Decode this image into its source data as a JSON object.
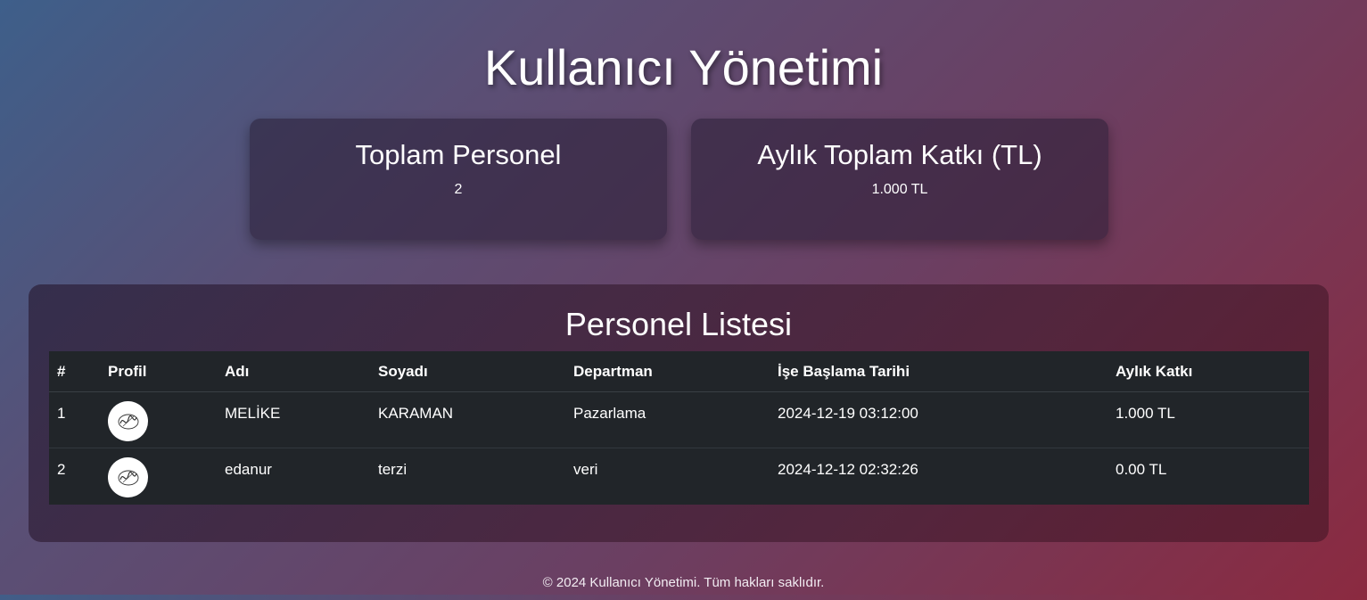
{
  "page": {
    "title": "Kullanıcı Yönetimi"
  },
  "stats": [
    {
      "title": "Toplam Personel",
      "value": "2"
    },
    {
      "title": "Aylık Toplam Katkı (TL)",
      "value": "1.000 TL"
    }
  ],
  "personnel": {
    "title": "Personel Listesi",
    "columns": [
      "#",
      "Profil",
      "Adı",
      "Soyadı",
      "Departman",
      "İşe Başlama Tarihi",
      "Aylık Katkı"
    ],
    "rows": [
      {
        "num": "1",
        "name": "MELİKE",
        "surname": "KARAMAN",
        "department": "Pazarlama",
        "start_date": "2024-12-19 03:12:00",
        "contribution": "1.000 TL"
      },
      {
        "num": "2",
        "name": "edanur",
        "surname": "terzi",
        "department": "veri",
        "start_date": "2024-12-12 02:32:26",
        "contribution": "0.00 TL"
      }
    ]
  },
  "footer": {
    "text": "© 2024 Kullanıcı Yönetimi. Tüm hakları saklıdır."
  }
}
